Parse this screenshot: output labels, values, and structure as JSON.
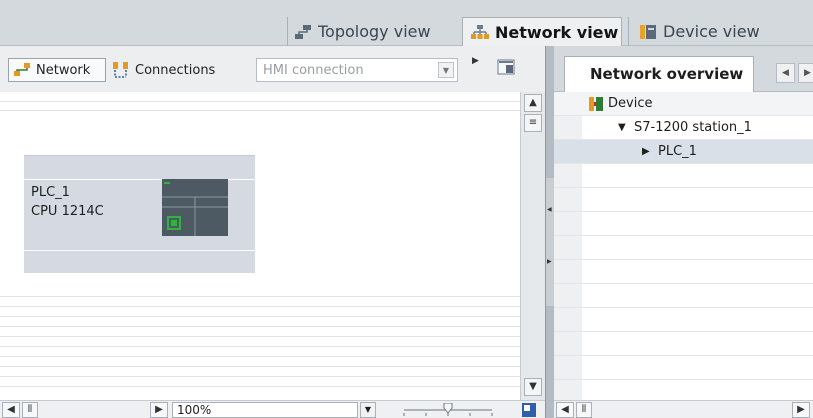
{
  "view_tabs": {
    "topology": "Topology view",
    "network": "Network view",
    "device": "Device view"
  },
  "toolbar": {
    "network_label": "Network",
    "connections_label": "Connections",
    "connection_type_value": "HMI connection"
  },
  "device": {
    "name": "PLC_1",
    "type": "CPU 1214C"
  },
  "bottom": {
    "zoom": "100%"
  },
  "overview": {
    "tab_label": "Network overview",
    "column_device": "Device",
    "rows": [
      {
        "label": "S7-1200 station_1",
        "expander": "▼"
      },
      {
        "label": "PLC_1",
        "expander": "▶"
      }
    ]
  },
  "colors": {
    "device_fill": "#d5dae2",
    "plc_body": "#4e5a63",
    "plc_led": "#2fb53c",
    "selected_row": "#d9e0e8"
  },
  "icons": {
    "topology": "topology-icon",
    "network": "network-icon",
    "device": "device-icon"
  }
}
